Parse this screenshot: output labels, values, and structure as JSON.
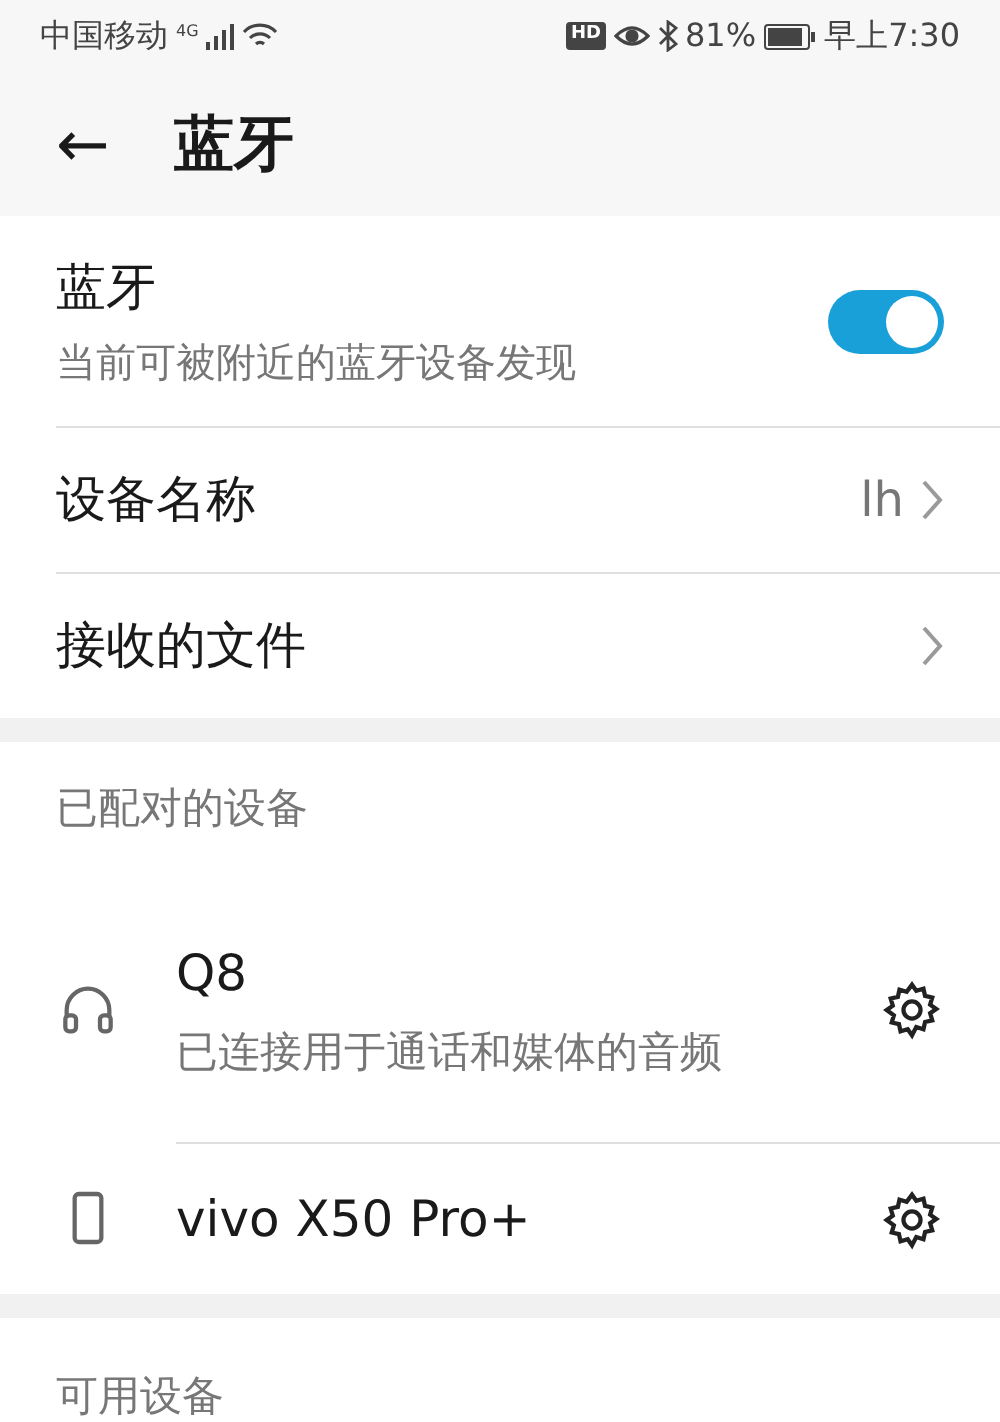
{
  "status_bar": {
    "carrier": "中国移动",
    "network": "4G",
    "hd": "HD",
    "battery": "81%",
    "time": "早上7:30"
  },
  "header": {
    "back": "←",
    "title": "蓝牙"
  },
  "bluetooth": {
    "title": "蓝牙",
    "subtitle": "当前可被附近的蓝牙设备发现",
    "on": true
  },
  "settings": [
    {
      "label": "设备名称",
      "value": "lh"
    },
    {
      "label": "接收的文件"
    }
  ],
  "paired": {
    "heading": "已配对的设备",
    "devices": [
      {
        "kind": "headset",
        "name": "Q8",
        "status": "已连接用于通话和媒体的音频"
      },
      {
        "kind": "phone",
        "name": "vivo X50 Pro+"
      }
    ]
  },
  "available": {
    "heading": "可用设备"
  }
}
